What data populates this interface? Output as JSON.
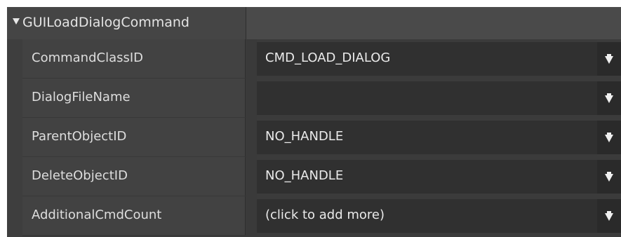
{
  "group": {
    "title": "GUILoadDialogCommand"
  },
  "rows": [
    {
      "name": "CommandClassID",
      "value": "CMD_LOAD_DIALOG"
    },
    {
      "name": "DialogFileName",
      "value": ""
    },
    {
      "name": "ParentObjectID",
      "value": "NO_HANDLE"
    },
    {
      "name": "DeleteObjectID",
      "value": "NO_HANDLE"
    },
    {
      "name": "AdditionalCmdCount",
      "value": "(click to add more)"
    }
  ],
  "icons": {
    "expand": "triangle-down-icon",
    "dropdown": "dropdown-arrow-icon"
  },
  "colors": {
    "panel_bg": "#3b3b3b",
    "value_bg": "#303030",
    "text": "#e4e4e4"
  }
}
